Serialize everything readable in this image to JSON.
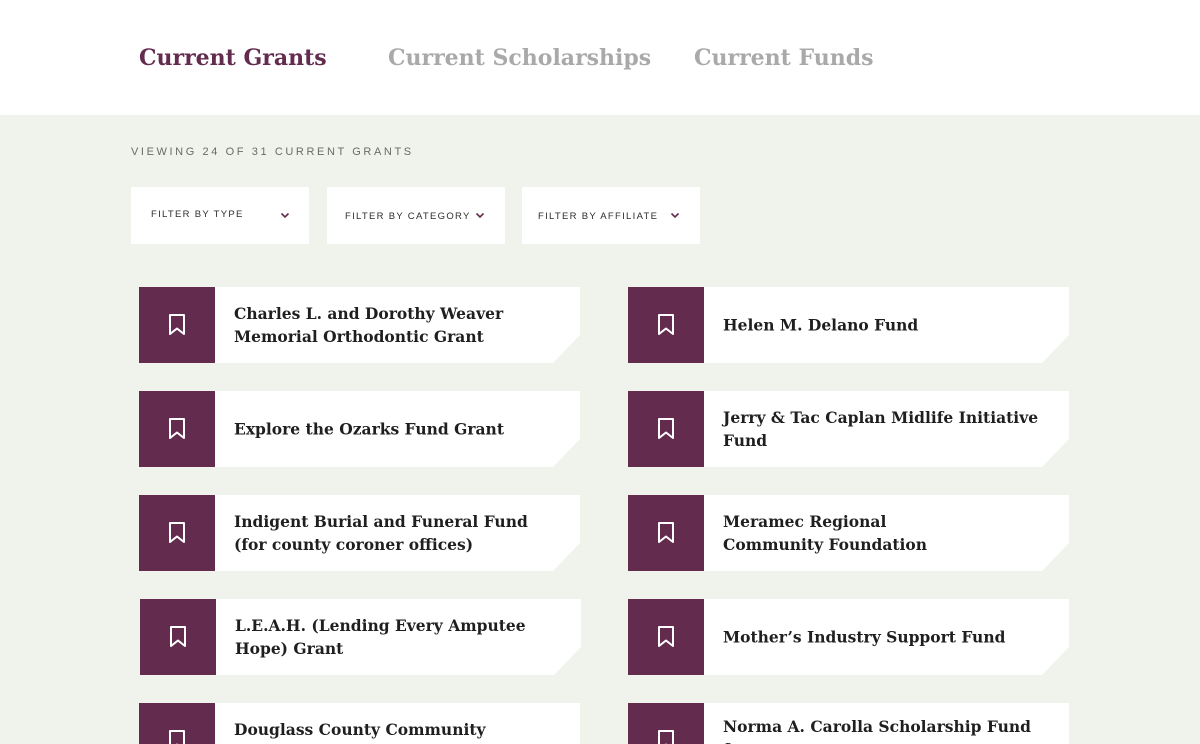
{
  "tabs": [
    {
      "label": "Current Grants",
      "active": true
    },
    {
      "label": "Current Scholarships",
      "active": false
    },
    {
      "label": "Current Funds",
      "active": false
    }
  ],
  "viewing_text": "VIEWING 24 OF 31 CURRENT GRANTS",
  "filters": [
    {
      "label": "FILTER BY TYPE",
      "icon": "chevron-down-icon"
    },
    {
      "label": "FILTER BY CATEGORY",
      "icon": "chevron-down-icon"
    },
    {
      "label": "FILTER BY AFFILIATE",
      "icon": "chevron-down-icon"
    }
  ],
  "grants": [
    {
      "title": "Charles L. and Dorothy Weaver Memorial Orthodontic Grant",
      "icon": "bookmark-icon"
    },
    {
      "title": "Helen M. Delano Fund",
      "icon": "bookmark-icon"
    },
    {
      "title": "Explore the Ozarks Fund Grant",
      "icon": "bookmark-icon"
    },
    {
      "title": "Jerry & Tac Caplan Midlife Initiative Fund",
      "icon": "bookmark-icon"
    },
    {
      "title": "Indigent Burial and Funeral Fund (for county coroner offices)",
      "icon": "bookmark-icon"
    },
    {
      "title": "Meramec Regional Community Foundation",
      "icon": "bookmark-icon"
    },
    {
      "title": "L.E.A.H. (Lending Every Amputee Hope) Grant",
      "icon": "bookmark-icon"
    },
    {
      "title": "Mother’s Industry Support Fund",
      "icon": "bookmark-icon"
    },
    {
      "title": "Douglass County Community Foundation",
      "icon": "bookmark-icon"
    },
    {
      "title": "Norma A. Carolla Scholarship Fund for",
      "icon": "bookmark-icon"
    }
  ],
  "colors": {
    "accent": "#632c4f",
    "inactive_tab": "#a9a9a9",
    "background": "#eff3ec",
    "card": "#ffffff"
  }
}
